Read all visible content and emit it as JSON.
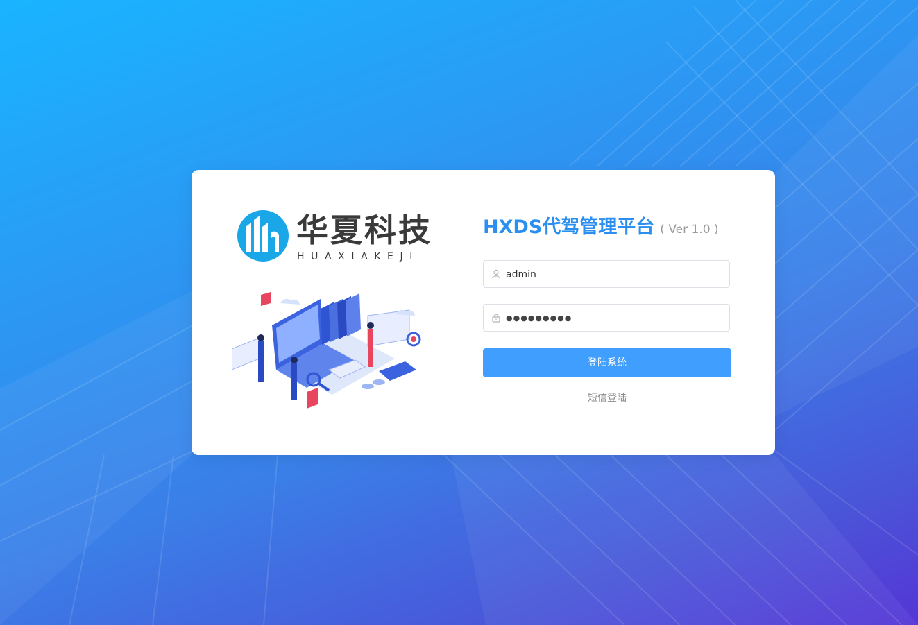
{
  "brand": {
    "name_cn": "华夏科技",
    "name_en": "HUAXIAKEJI"
  },
  "login": {
    "title": "HXDS代驾管理平台",
    "version": "( Ver 1.0 )",
    "username": {
      "value": "admin",
      "icon": "user-icon"
    },
    "password": {
      "value": "●●●●●●●●●",
      "icon": "lock-icon"
    },
    "submit_label": "登陆系统",
    "sms_login_label": "短信登陆"
  },
  "colors": {
    "accent": "#409eff",
    "title": "#2b8ff0",
    "background_start": "#19b4ff",
    "background_end": "#5535d6"
  }
}
